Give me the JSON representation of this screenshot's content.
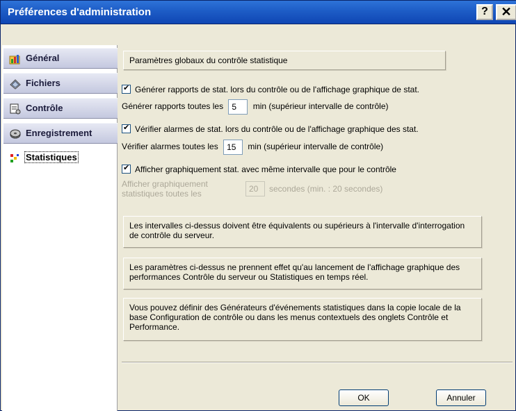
{
  "window": {
    "title": "Préférences d'administration",
    "help_glyph": "?",
    "close_glyph": "✕"
  },
  "sidebar": {
    "items": [
      {
        "label": "Général",
        "icon": "folder-chart-icon"
      },
      {
        "label": "Fichiers",
        "icon": "files-icon"
      },
      {
        "label": "Contrôle",
        "icon": "monitor-icon"
      },
      {
        "label": "Enregistrement",
        "icon": "disk-icon"
      },
      {
        "label": "Statistiques",
        "icon": "stats-icon",
        "active": true
      }
    ]
  },
  "main": {
    "header": "Paramètres globaux du contrôle statistique",
    "generate_reports_check": "Générer rapports de stat. lors du contrôle ou de l'affichage graphique de stat.",
    "generate_reports_every_label": "Générer rapports toutes les",
    "generate_reports_every_value": "5",
    "generate_reports_suffix": "min (supérieur intervalle de contrôle)",
    "verify_alarms_check": "Vérifier alarmes de stat. lors du contrôle ou de l'affichage graphique des stat.",
    "verify_alarms_every_label": "Vérifier alarmes toutes les",
    "verify_alarms_every_value": "15",
    "verify_alarms_suffix": "min (supérieur intervalle de contrôle)",
    "display_graph_check": "Afficher graphiquement stat. avec même intervalle que pour le contrôle",
    "display_graph_every_label_1": "Afficher graphiquement",
    "display_graph_every_label_2": "statistiques toutes les",
    "display_graph_every_value": "20",
    "display_graph_suffix": "secondes (min. : 20 secondes)",
    "info_1": "Les intervalles ci-dessus doivent être équivalents ou supérieurs à l'intervalle d'interrogation de contrôle du serveur.",
    "info_2": "Les paramètres ci-dessus ne prennent effet qu'au lancement de l'affichage graphique des performances Contrôle du serveur ou Statistiques en temps réel.",
    "info_3": "Vous pouvez définir des Générateurs d'événements statistiques dans la copie locale de la base Configuration de contrôle ou dans les menus contextuels des onglets Contrôle et Performance."
  },
  "footer": {
    "ok_label": "OK",
    "cancel_label": "Annuler"
  },
  "colors": {
    "titlebar": "#1d5cc6",
    "dialog_bg": "#ece9d8"
  }
}
